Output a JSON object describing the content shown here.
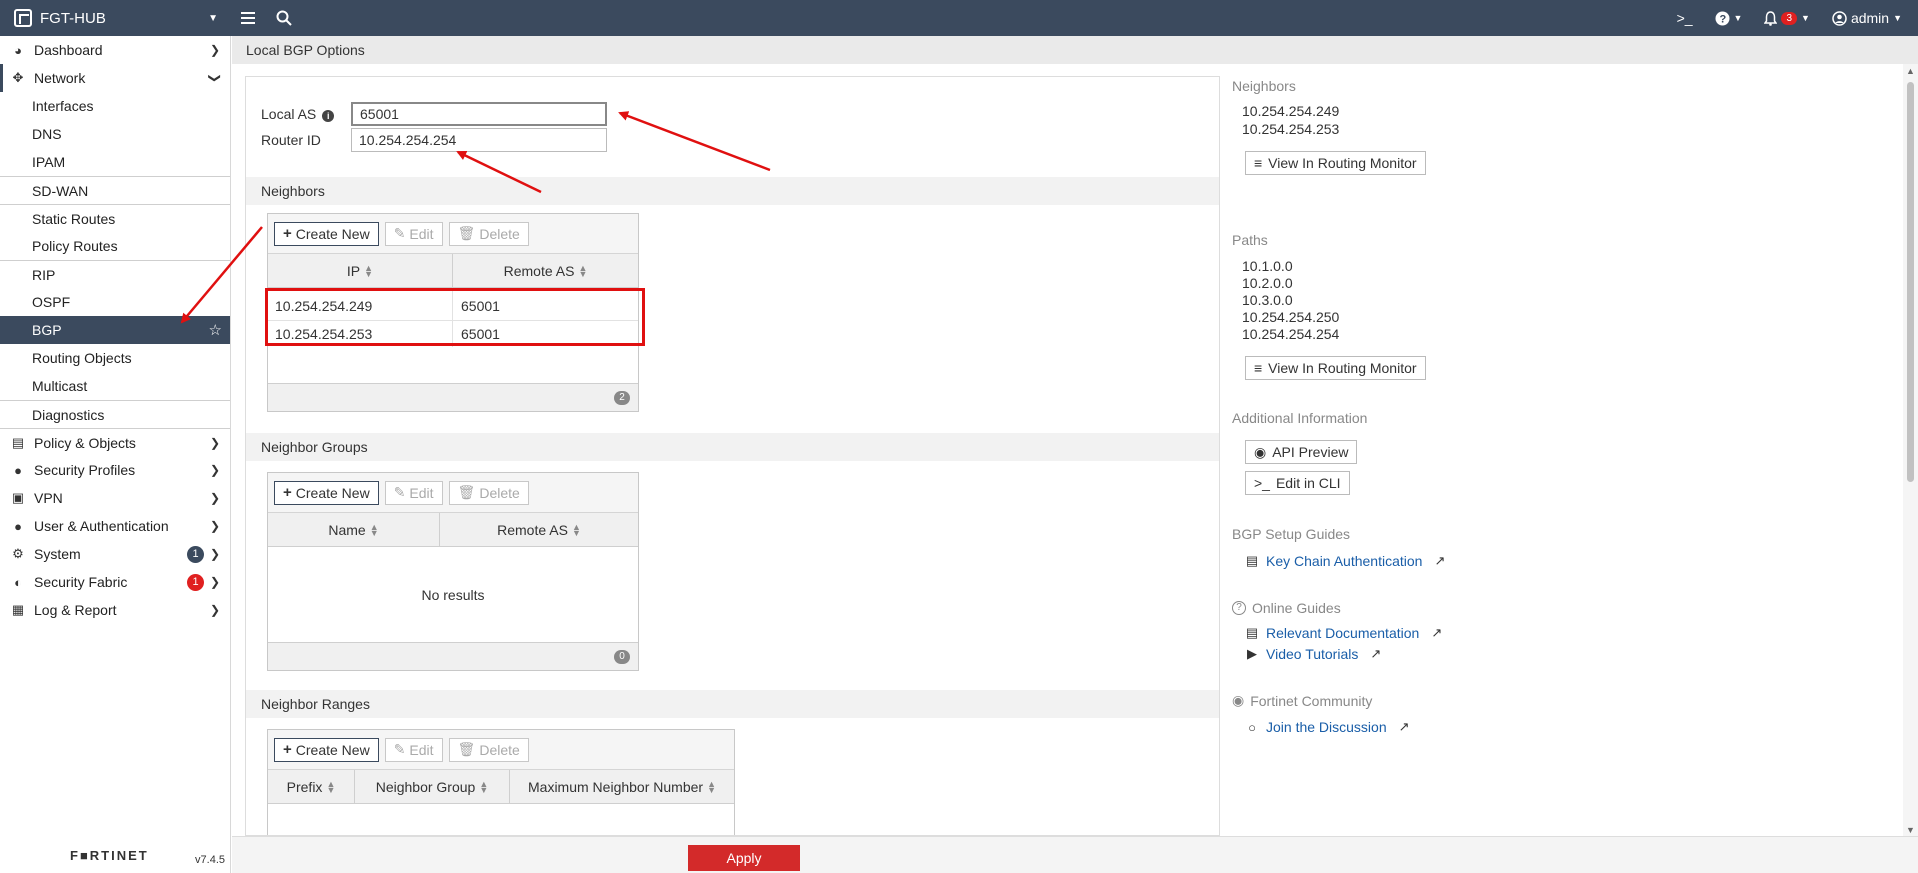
{
  "topbar": {
    "hostname": "FGT-HUB",
    "notif_count": "3",
    "user": "admin"
  },
  "sidebar": {
    "items": [
      {
        "label": "Dashboard"
      },
      {
        "label": "Network"
      },
      {
        "label": "Interfaces"
      },
      {
        "label": "DNS"
      },
      {
        "label": "IPAM"
      },
      {
        "label": "SD-WAN"
      },
      {
        "label": "Static Routes"
      },
      {
        "label": "Policy Routes"
      },
      {
        "label": "RIP"
      },
      {
        "label": "OSPF"
      },
      {
        "label": "BGP"
      },
      {
        "label": "Routing Objects"
      },
      {
        "label": "Multicast"
      },
      {
        "label": "Diagnostics"
      },
      {
        "label": "Policy & Objects"
      },
      {
        "label": "Security Profiles"
      },
      {
        "label": "VPN"
      },
      {
        "label": "User & Authentication"
      },
      {
        "label": "System",
        "count": "1"
      },
      {
        "label": "Security Fabric",
        "count": "1"
      },
      {
        "label": "Log & Report"
      }
    ],
    "brand": "F■RTINET",
    "version": "v7.4.5"
  },
  "page": {
    "title": "Local BGP Options"
  },
  "form": {
    "local_as_label": "Local AS",
    "local_as_value": "65001",
    "router_id_label": "Router ID",
    "router_id_value": "10.254.254.254"
  },
  "toolbar": {
    "create_new": "Create New",
    "edit": "Edit",
    "delete": "Delete"
  },
  "neighbors": {
    "title": "Neighbors",
    "columns": [
      "IP",
      "Remote AS"
    ],
    "rows": [
      [
        "10.254.254.249",
        "65001"
      ],
      [
        "10.254.254.253",
        "65001"
      ]
    ],
    "count": "2"
  },
  "neighbor_groups": {
    "title": "Neighbor Groups",
    "columns": [
      "Name",
      "Remote AS"
    ],
    "empty_text": "No results",
    "count": "0"
  },
  "neighbor_ranges": {
    "title": "Neighbor Ranges",
    "columns": [
      "Prefix",
      "Neighbor Group",
      "Maximum Neighbor Number"
    ]
  },
  "right_pane": {
    "neighbors_title": "Neighbors",
    "neighbors": [
      "10.254.254.249",
      "10.254.254.253"
    ],
    "view_monitor": "View In Routing Monitor",
    "paths_title": "Paths",
    "paths": [
      "10.1.0.0",
      "10.2.0.0",
      "10.3.0.0",
      "10.254.254.250",
      "10.254.254.254"
    ],
    "additional_title": "Additional Information",
    "api_preview": "API Preview",
    "edit_cli": "Edit in CLI",
    "setup_title": "BGP Setup Guides",
    "key_chain": "Key Chain Authentication",
    "online_title": "Online Guides",
    "relevant_docs": "Relevant Documentation",
    "video_tutorials": "Video Tutorials",
    "community_title": "Fortinet Community",
    "join_discussion": "Join the Discussion"
  },
  "footer": {
    "apply": "Apply"
  },
  "colors": {
    "topbar": "#3b4a5e",
    "apply": "#d32a2a",
    "annotation": "#e01010",
    "link": "#1a5ea8"
  }
}
